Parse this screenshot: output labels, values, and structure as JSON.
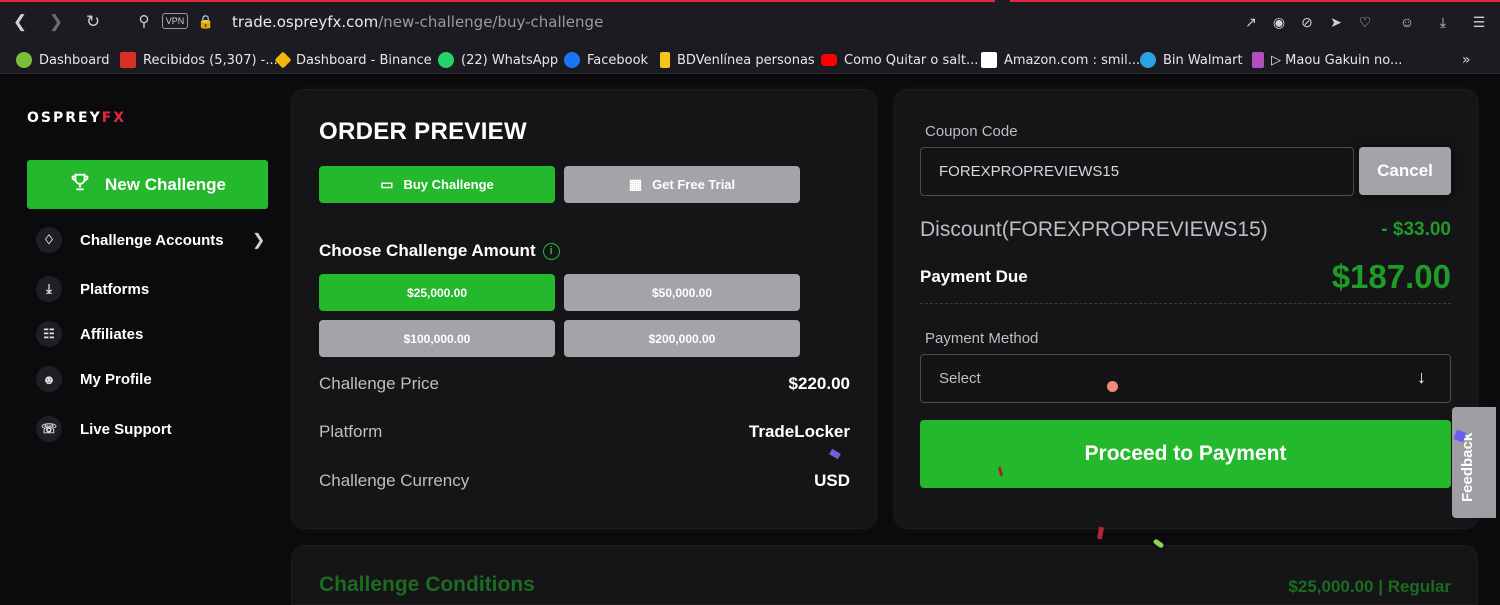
{
  "browser": {
    "url_domain": "trade.ospreyfx.com",
    "url_path": "/new-challenge/buy-challenge",
    "vpn_label": "VPN"
  },
  "bookmarks": [
    {
      "label": "Dashboard",
      "color": "#7cbf3a"
    },
    {
      "label": "Recibidos (5,307) -...",
      "color": "#d93025"
    },
    {
      "label": "Dashboard - Binance",
      "color": "#f0b90b"
    },
    {
      "label": "(22) WhatsApp",
      "color": "#25d366"
    },
    {
      "label": "Facebook",
      "color": "#1877f2"
    },
    {
      "label": "BDVenlínea personas",
      "color": "#f5c518"
    },
    {
      "label": "Como Quitar o salt...",
      "color": "#ff0000"
    },
    {
      "label": "Amazon.com : smil...",
      "color": "#ffffff"
    },
    {
      "label": "Bin Walmart",
      "color": "#2aa3e0"
    },
    {
      "label": "▷ Maou Gakuin no...",
      "color": "#b04fbf"
    }
  ],
  "sidebar": {
    "logo_main": "OSPREY",
    "logo_accent": "FX",
    "new_challenge": "New Challenge",
    "items": [
      {
        "label": "Challenge Accounts",
        "icon": "trophy-icon"
      },
      {
        "label": "Platforms",
        "icon": "download-icon"
      },
      {
        "label": "Affiliates",
        "icon": "sitemap-icon"
      },
      {
        "label": "My Profile",
        "icon": "user-icon"
      },
      {
        "label": "Live Support",
        "icon": "headset-icon"
      }
    ]
  },
  "order": {
    "title": "ORDER PREVIEW",
    "buy_challenge": "Buy Challenge",
    "free_trial": "Get Free Trial",
    "choose_amount": "Choose Challenge Amount",
    "amounts": [
      "$25,000.00",
      "$50,000.00",
      "$100,000.00",
      "$200,000.00"
    ],
    "selected_amount": "$25,000.00",
    "rows": [
      {
        "label": "Challenge Price",
        "value": "$220.00"
      },
      {
        "label": "Platform",
        "value": "TradeLocker"
      },
      {
        "label": "Challenge Currency",
        "value": "USD"
      }
    ]
  },
  "payment": {
    "coupon_label": "Coupon Code",
    "coupon_value": "FOREXPROPREVIEWS15",
    "cancel": "Cancel",
    "discount_label": "Discount(FOREXPROPREVIEWS15)",
    "discount_value": "- $33.00",
    "due_label": "Payment Due",
    "due_value": "$187.00",
    "method_label": "Payment Method",
    "method_placeholder": "Select",
    "proceed": "Proceed to Payment"
  },
  "feedback": "Feedback",
  "conditions": {
    "title": "Challenge Conditions",
    "summary": "$25,000.00 | Regular"
  },
  "colors": {
    "accent_green": "#24b82d",
    "price_green": "#1f9c27",
    "button_grey": "#a3a3a8",
    "card_bg": "#151517"
  }
}
